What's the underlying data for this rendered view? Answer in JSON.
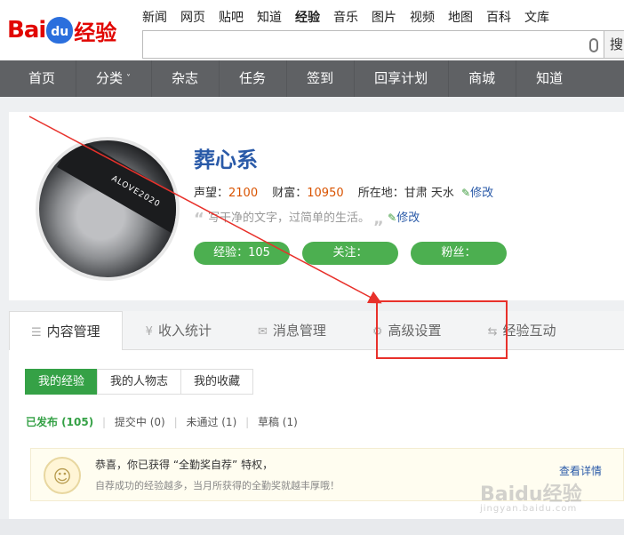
{
  "brand": {
    "bai": "Bai",
    "du": "du",
    "suffix": "经验"
  },
  "top_nav": [
    "新闻",
    "网页",
    "贴吧",
    "知道",
    "经验",
    "音乐",
    "图片",
    "视频",
    "地图",
    "百科",
    "文库"
  ],
  "search": {
    "button": "搜"
  },
  "main_nav": {
    "home": "首页",
    "category": "分类",
    "caret": "˅",
    "magazine": "杂志",
    "task": "任务",
    "signin": "签到",
    "share_plan": "回享计划",
    "mall": "商城",
    "zhidao": "知道"
  },
  "profile": {
    "name": "葬心系",
    "reputation_label": "声望：",
    "reputation": "2100",
    "wealth_label": "财富：",
    "wealth": "10950",
    "location_label": "所在地：",
    "location": "甘肃 天水",
    "edit": "修改",
    "motto": "写干净的文字，过简单的生活。",
    "quote_open": "“",
    "quote_close": "„",
    "pencil": "✎",
    "avatar_text": "ALOVE2020",
    "pills": {
      "exp": "经验：105",
      "follow": "关注：",
      "fans": "粉丝："
    }
  },
  "tabs": {
    "content_mgmt": "内容管理",
    "income": "收入统计",
    "messages": "消息管理",
    "advanced": "高级设置",
    "interaction": "经验互动",
    "icons": {
      "list": "☰",
      "yen": "¥",
      "mail": "✉",
      "gear": "⚙",
      "swap": "⇆"
    }
  },
  "subtabs": {
    "my_exp": "我的经验",
    "my_people": "我的人物志",
    "my_fav": "我的收藏"
  },
  "filters": {
    "published": "已发布 (105)",
    "submitting": "提交中 (0)",
    "rejected": "未通过 (1)",
    "drafts": "草稿 (1)",
    "sep": "|"
  },
  "notice": {
    "title": "恭喜，你已获得 “全勤奖自荐” 特权，",
    "subtitle": "自荐成功的经验越多，当月所获得的全勤奖就越丰厚哦！",
    "more": "查看详情",
    "medal": "☺"
  },
  "watermark": {
    "text": "Baidu经验",
    "url": "jingyan.baidu.com"
  },
  "annotation": {
    "color": "#e8312b"
  }
}
